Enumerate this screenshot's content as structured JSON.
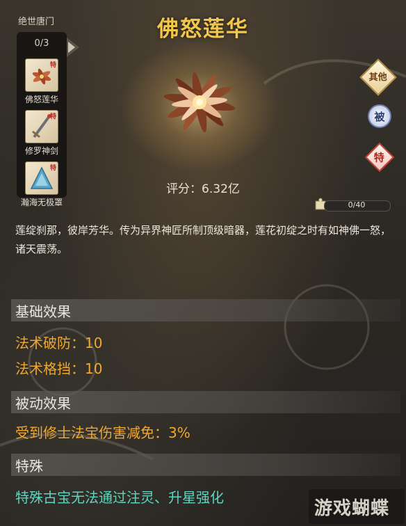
{
  "set": {
    "name": "绝世唐门",
    "count": "0/3",
    "items": [
      {
        "label": "佛怒莲华",
        "tag": "特"
      },
      {
        "label": "修罗神剑",
        "tag": "特"
      },
      {
        "label": "瀚海无极罩",
        "tag": "特"
      }
    ]
  },
  "item": {
    "title": "佛怒莲华",
    "score": "评分：6.32亿",
    "description": "莲绽刹那，彼岸芳华。传为异界神匠所制顶级暗器，莲花初绽之时有如神佛一怒，诸天震荡。"
  },
  "side_buttons": {
    "other": "其他",
    "passive": "被",
    "special": "特"
  },
  "progress": {
    "text": "0/40",
    "fraction": 0.0
  },
  "sections": {
    "basic": {
      "heading": "基础效果",
      "stats": [
        "法术破防：10",
        "法术格挡：10"
      ]
    },
    "passive": {
      "heading": "被动效果",
      "stats": [
        "受到修士法宝伤害减免：3%"
      ]
    },
    "special": {
      "heading": "特殊",
      "text": "特殊古宝无法通过注灵、升星强化"
    }
  },
  "watermark": "游戏蝴蝶",
  "colors": {
    "title": "#f2c74a",
    "stat": "#f0a830",
    "special": "#5cd6c0"
  }
}
